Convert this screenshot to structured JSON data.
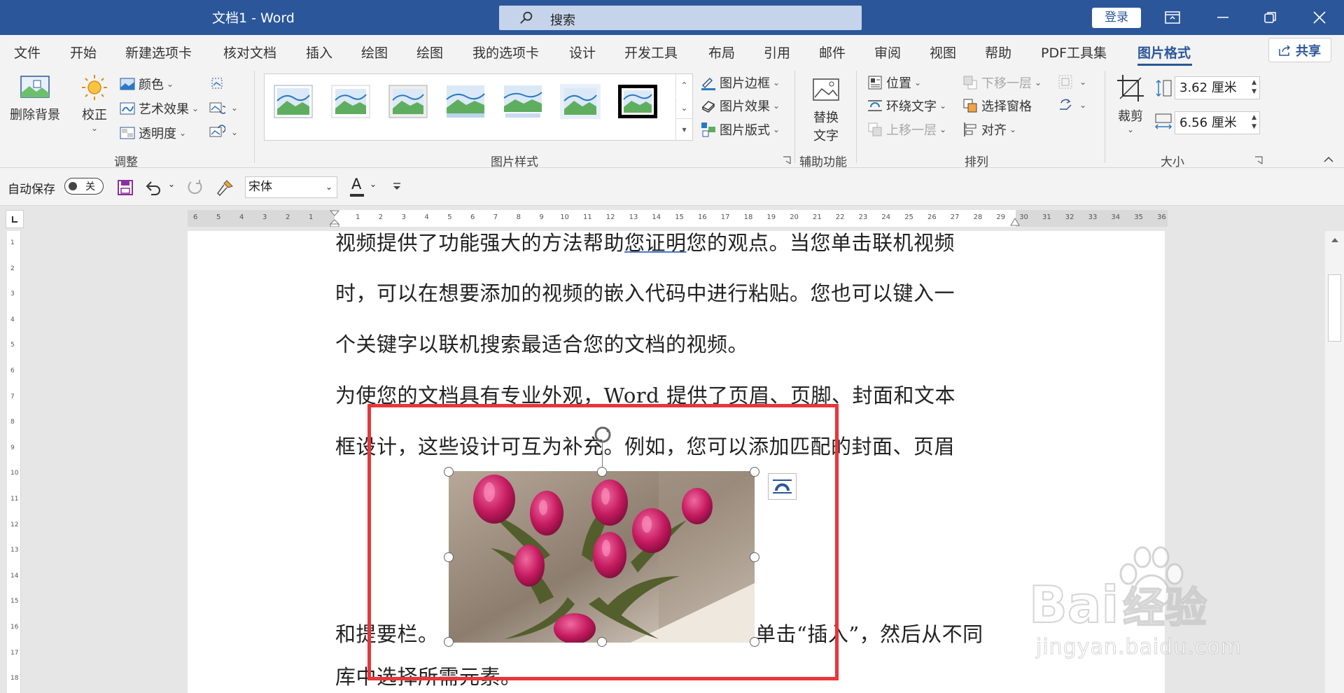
{
  "window": {
    "title": "文档1  -  Word",
    "search_placeholder": "搜索",
    "login_label": "登录"
  },
  "tabs": [
    {
      "label": "文件"
    },
    {
      "label": "开始"
    },
    {
      "label": "新建选项卡"
    },
    {
      "label": "核对文档"
    },
    {
      "label": "插入"
    },
    {
      "label": "绘图"
    },
    {
      "label": "绘图"
    },
    {
      "label": "我的选项卡"
    },
    {
      "label": "设计"
    },
    {
      "label": "开发工具"
    },
    {
      "label": "布局"
    },
    {
      "label": "引用"
    },
    {
      "label": "邮件"
    },
    {
      "label": "审阅"
    },
    {
      "label": "视图"
    },
    {
      "label": "帮助"
    },
    {
      "label": "PDF工具集"
    },
    {
      "label": "图片格式",
      "active": true
    }
  ],
  "share_label": "共享",
  "ribbon": {
    "adjust": {
      "remove_bg": "删除背景",
      "correct": "校正",
      "color": "颜色",
      "art_effect": "艺术效果",
      "transparency": "透明度",
      "group_label": "调整"
    },
    "styles": {
      "border": "图片边框",
      "effect": "图片效果",
      "layout": "图片版式",
      "group_label": "图片样式"
    },
    "accessibility": {
      "alt_text_line1": "替换",
      "alt_text_line2": "文字",
      "group_label": "辅助功能"
    },
    "arrange": {
      "position": "位置",
      "wrap_text": "环绕文字",
      "bring_forward": "上移一层",
      "send_backward": "下移一层",
      "selection_pane": "选择窗格",
      "align": "对齐",
      "group_label": "排列"
    },
    "size": {
      "crop": "裁剪",
      "height": "3.62 厘米",
      "width": "6.56 厘米",
      "group_label": "大小"
    }
  },
  "qat": {
    "autosave_label": "自动保存",
    "autosave_state": "关",
    "font_name": "宋体",
    "font_color_letter": "A"
  },
  "ruler": {
    "left_ticks": [
      "6",
      "5",
      "4",
      "3",
      "2",
      "1"
    ],
    "right_ticks": [
      "1",
      "2",
      "3",
      "4",
      "5",
      "6",
      "7",
      "8",
      "9",
      "10",
      "11",
      "12",
      "13",
      "14",
      "15",
      "16",
      "17",
      "18",
      "19",
      "20",
      "21",
      "22",
      "23",
      "24",
      "25",
      "26",
      "27",
      "28",
      "29",
      "30",
      "31",
      "32",
      "33",
      "34",
      "35",
      "36"
    ]
  },
  "document": {
    "line1_a": "视频提供了功能强大的方法帮助",
    "line1_link": "您证明",
    "line1_b": "您的观点。当您单击联机视频",
    "line2": "时，可以在想要添加的视频的嵌入代码中进行粘贴。您也可以键入一",
    "line3": "个关键字以联机搜索最适合您的文档的视频。",
    "line4": "为使您的文档具有专业外观，Word 提供了页眉、页脚、封面和文本",
    "line5": "框设计，这些设计可互为补充。例如，您可以添加匹配的封面、页眉",
    "line6_a": "和提要栏。",
    "line6_b": "单击“插入”，然后从不同",
    "line7": "库中选择所需元素。"
  },
  "watermark": {
    "brand": "Bai",
    "brand_cn": "经验",
    "url": "jingyan.baidu.com"
  },
  "colors": {
    "titlebar": "#2b579a",
    "highlight_box": "#e8363b"
  }
}
